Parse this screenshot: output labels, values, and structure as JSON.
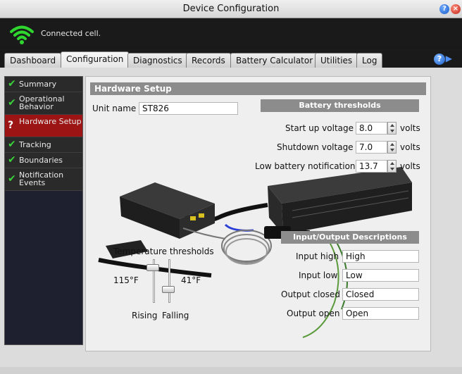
{
  "window": {
    "title": "Device Configuration"
  },
  "status": {
    "text": "Connected cell."
  },
  "tabs": [
    {
      "label": "Dashboard"
    },
    {
      "label": "Configuration"
    },
    {
      "label": "Diagnostics"
    },
    {
      "label": "Records"
    },
    {
      "label": "Battery Calculator"
    },
    {
      "label": "Utilities"
    },
    {
      "label": "Log"
    }
  ],
  "sidebar": {
    "items": [
      {
        "label": "Summary",
        "status": "check"
      },
      {
        "label": "Operational Behavior",
        "status": "check"
      },
      {
        "label": "Hardware Setup",
        "status": "warning"
      },
      {
        "label": "Tracking",
        "status": "check"
      },
      {
        "label": "Boundaries",
        "status": "check"
      },
      {
        "label": "Notification Events",
        "status": "check"
      }
    ]
  },
  "hardware": {
    "header": "Hardware Setup",
    "unit_name_label": "Unit name",
    "unit_name_value": "ST826"
  },
  "battery": {
    "header": "Battery thresholds",
    "startup_label": "Start up voltage",
    "startup_value": "8.0",
    "shutdown_label": "Shutdown voltage",
    "shutdown_value": "7.0",
    "low_label": "Low battery notification",
    "low_value": "13.7",
    "unit": "volts"
  },
  "io": {
    "header": "Input/Output Descriptions",
    "input_high_label": "Input high",
    "input_high_value": "High",
    "input_low_label": "Input low",
    "input_low_value": "Low",
    "output_closed_label": "Output closed",
    "output_closed_value": "Closed",
    "output_open_label": "Output open",
    "output_open_value": "Open"
  },
  "temperature": {
    "title": "Temperature thresholds",
    "rising_value": "115°F",
    "falling_value": "41°F",
    "rising_label": "Rising",
    "falling_label": "Falling"
  },
  "colors": {
    "accent_red": "#9d1414",
    "check_green": "#3ad23a",
    "header_gray": "#8c8c8c"
  }
}
